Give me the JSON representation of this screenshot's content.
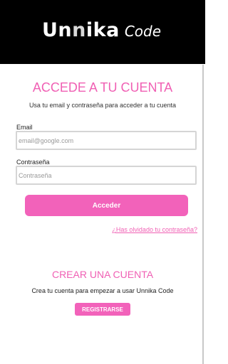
{
  "header": {
    "logo_brand_a": "Un",
    "logo_brand_n": "n",
    "logo_brand_b": "ika",
    "logo_sub": "Code"
  },
  "login": {
    "title": "ACCEDE A TU CUENTA",
    "subtitle": "Usa tu email y contraseña para acceder a tu cuenta",
    "email_label": "Email",
    "email_placeholder": "email@google.com",
    "password_label": "Contraseña",
    "password_placeholder": "Contraseña",
    "submit_label": "Acceder",
    "forgot_link": "¿Has olvidado tu contraseña?"
  },
  "register": {
    "title": "CREAR UNA CUENTA",
    "subtitle": "Crea tu cuenta para empezar a usar Unnika Code",
    "button_label": "REGISTRARSE"
  },
  "colors": {
    "accent": "#f060b4",
    "button": "#f262ba",
    "header_bg": "#000000"
  }
}
